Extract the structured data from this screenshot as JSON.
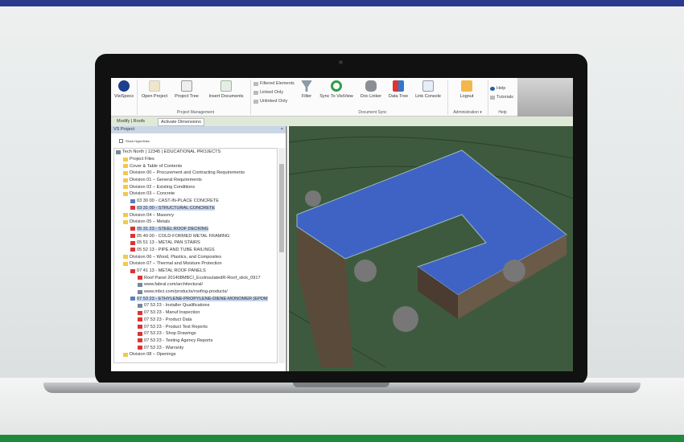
{
  "ribbon": {
    "visispecs": "VisiSpecs",
    "open_project": "Open Project",
    "project_tree": "Project Tree",
    "insert_documents": "Insert Documents",
    "filtered_elements": "Filtered Elements",
    "linked_only": "Linked Only",
    "unlinked_only": "Unlinked Only",
    "filter": "Filter",
    "sync": "Sync To VisiView",
    "doc_linker": "Doc Linker",
    "data_tree": "Data Tree",
    "link_console": "Link Console",
    "logout": "Logout",
    "help": "Help",
    "tutorials": "Tutorials",
    "groups": {
      "project_management": "Project Management",
      "document_sync": "Document Sync",
      "administration": "Administration ▾",
      "help": "Help"
    }
  },
  "tabs": {
    "modify": "Modify | Roofs",
    "activate": "Activate Dimensions"
  },
  "panel": {
    "title": "VS Project",
    "close": "×",
    "show_links": "Show Hyperlinks",
    "tree": [
      {
        "t": "Tech North | 12345 | EDUCATIONAL PROJECTS",
        "l": 0,
        "i": "w"
      },
      {
        "t": "Project Files",
        "l": 1,
        "i": "f"
      },
      {
        "t": "Cover & Table of Contents",
        "l": 1,
        "i": "f"
      },
      {
        "t": "Division 00 – Procurement and Contracting Requirements",
        "l": 1,
        "i": "f"
      },
      {
        "t": "Division 01 – General Requirements",
        "l": 1,
        "i": "f"
      },
      {
        "t": "Division 02 – Existing Conditions",
        "l": 1,
        "i": "f"
      },
      {
        "t": "Division 03 – Concrete",
        "l": 1,
        "i": "f"
      },
      {
        "t": "03 30 00 - CAST-IN-PLACE CONCRETE",
        "l": 2,
        "i": "d"
      },
      {
        "t": "03 31 00 - STRUCTURAL CONCRETE",
        "l": 2,
        "i": "p",
        "s": 1
      },
      {
        "t": "Division 04 – Masonry",
        "l": 1,
        "i": "f"
      },
      {
        "t": "Division 05 – Metals",
        "l": 1,
        "i": "f"
      },
      {
        "t": "05 31 23 - STEEL ROOF DECKING",
        "l": 2,
        "i": "p",
        "s": 1
      },
      {
        "t": "05 40 00 - COLD-FORMED METAL FRAMING",
        "l": 2,
        "i": "p"
      },
      {
        "t": "05 51 13 - METAL PAN STAIRS",
        "l": 2,
        "i": "p"
      },
      {
        "t": "05 52 13 - PIPE AND TUBE RAILINGS",
        "l": 2,
        "i": "p"
      },
      {
        "t": "Division 06 – Wood, Plastics, and Composites",
        "l": 1,
        "i": "f"
      },
      {
        "t": "Division 07 – Thermal and Moisture Protection",
        "l": 1,
        "i": "f"
      },
      {
        "t": "07 41 13 - METAL ROOF PANELS",
        "l": 2,
        "i": "p"
      },
      {
        "t": "Roof Panel 201408MBCI_EcoInsulatedR-Roof_slick_0917",
        "l": 3,
        "i": "p"
      },
      {
        "t": "www.fabral.com/architectural/",
        "l": 3,
        "i": "w"
      },
      {
        "t": "www.mbci.com/products/roofing-products/",
        "l": 3,
        "i": "w"
      },
      {
        "t": "07 53 23 - ETHYLENE-PROPYLENE-DIENE-MONOMER (EPDM",
        "l": 2,
        "i": "d",
        "s": 1
      },
      {
        "t": "07 53 23 - Installer Qualifications",
        "l": 3,
        "i": "w"
      },
      {
        "t": "07 53 23 - Manuf Inspection",
        "l": 3,
        "i": "p"
      },
      {
        "t": "07 53 23 - Product Data",
        "l": 3,
        "i": "p"
      },
      {
        "t": "07 53 23 - Product Test Reports",
        "l": 3,
        "i": "p"
      },
      {
        "t": "07 53 23 - Shop Drawings",
        "l": 3,
        "i": "p"
      },
      {
        "t": "07 53 23 - Testing Agency Reports",
        "l": 3,
        "i": "p"
      },
      {
        "t": "07 53 23 - Warranty",
        "l": 3,
        "i": "p"
      },
      {
        "t": "Division 08 – Openings",
        "l": 1,
        "i": "f"
      }
    ]
  }
}
